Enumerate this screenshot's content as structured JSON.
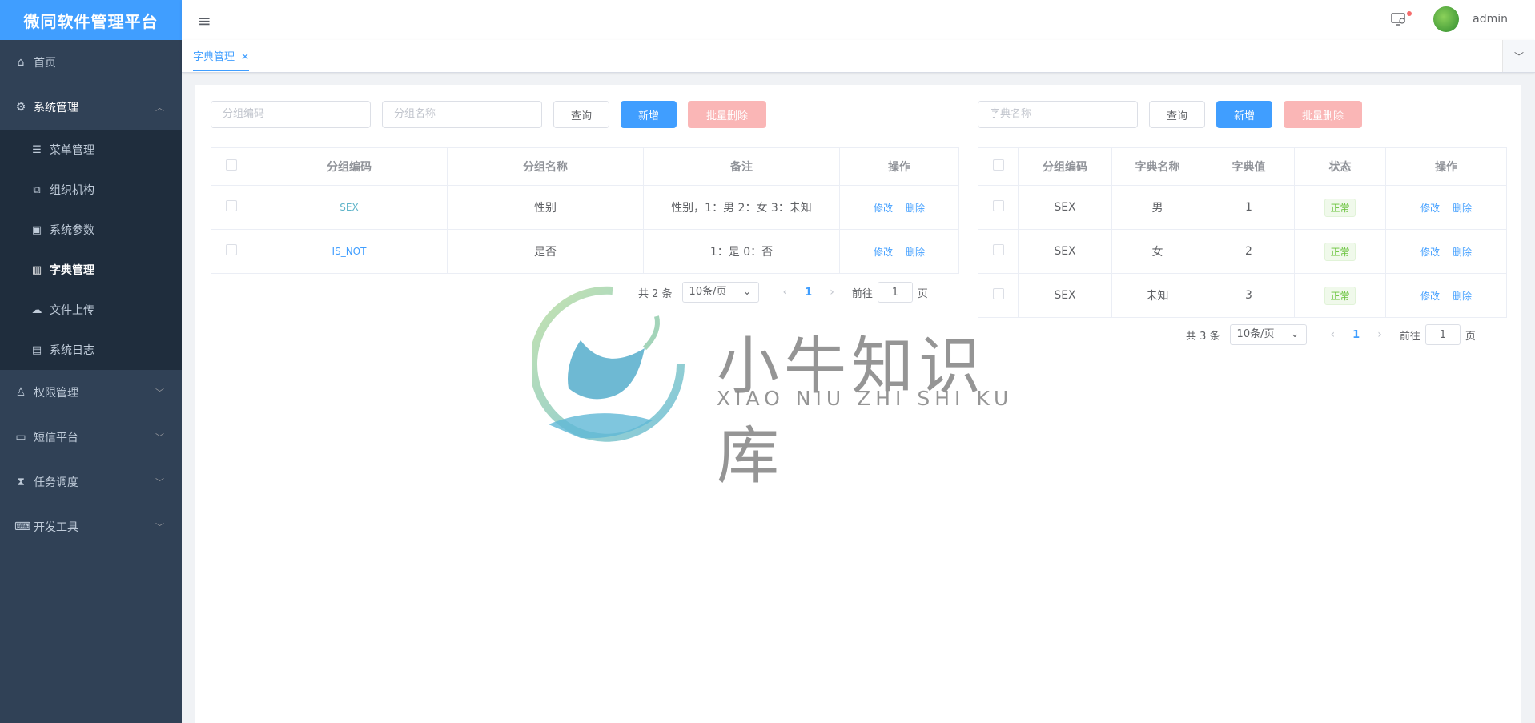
{
  "app": {
    "title": "微同软件管理平台"
  },
  "sidebar": {
    "items": [
      {
        "label": "首页",
        "icon": "home-icon"
      },
      {
        "label": "系统管理",
        "icon": "gear-icon"
      },
      {
        "label": "权限管理",
        "icon": "user-lock-icon"
      },
      {
        "label": "短信平台",
        "icon": "message-icon"
      },
      {
        "label": "任务调度",
        "icon": "task-icon"
      },
      {
        "label": "开发工具",
        "icon": "devtools-icon"
      }
    ],
    "sub_items": [
      {
        "label": "菜单管理",
        "icon": "list-icon"
      },
      {
        "label": "组织机构",
        "icon": "org-icon"
      },
      {
        "label": "系统参数",
        "icon": "params-icon"
      },
      {
        "label": "字典管理",
        "icon": "book-icon",
        "active": true
      },
      {
        "label": "文件上传",
        "icon": "upload-icon"
      },
      {
        "label": "系统日志",
        "icon": "log-icon"
      }
    ]
  },
  "header": {
    "username": "admin"
  },
  "tabs": [
    {
      "label": "字典管理",
      "active": true
    }
  ],
  "left": {
    "search": {
      "code_placeholder": "分组编码",
      "name_placeholder": "分组名称"
    },
    "buttons": {
      "query": "查询",
      "add": "新增",
      "batch_delete": "批量删除"
    },
    "columns": [
      "分组编码",
      "分组名称",
      "备注",
      "操作"
    ],
    "rows": [
      {
        "code": "SEX",
        "name": "性别",
        "remark": "性别，1：男 2：女 3：未知",
        "edit": "修改",
        "delete": "删除"
      },
      {
        "code": "IS_NOT",
        "name": "是否",
        "remark": "1：是 0：否",
        "edit": "修改",
        "delete": "删除"
      }
    ],
    "pagination": {
      "total": "共 2 条",
      "page_size": "10条/页",
      "current": "1",
      "goto": "前往",
      "page_input": "1",
      "page_unit": "页"
    }
  },
  "right": {
    "search": {
      "name_placeholder": "字典名称"
    },
    "buttons": {
      "query": "查询",
      "add": "新增",
      "batch_delete": "批量删除"
    },
    "columns": [
      "分组编码",
      "字典名称",
      "字典值",
      "状态",
      "操作"
    ],
    "rows": [
      {
        "code": "SEX",
        "name": "男",
        "value": "1",
        "status": "正常",
        "edit": "修改",
        "delete": "删除"
      },
      {
        "code": "SEX",
        "name": "女",
        "value": "2",
        "status": "正常",
        "edit": "修改",
        "delete": "删除"
      },
      {
        "code": "SEX",
        "name": "未知",
        "value": "3",
        "status": "正常",
        "edit": "修改",
        "delete": "删除"
      }
    ],
    "pagination": {
      "total": "共 3 条",
      "page_size": "10条/页",
      "current": "1",
      "goto": "前往",
      "page_input": "1",
      "page_unit": "页"
    }
  },
  "watermark": {
    "cn": "小牛知识库",
    "en": "XIAO NIU ZHI SHI KU"
  },
  "colors": {
    "primary": "#409eff",
    "sidebar": "#304156",
    "danger_disabled": "#fab6b6",
    "success": "#67c23a"
  }
}
